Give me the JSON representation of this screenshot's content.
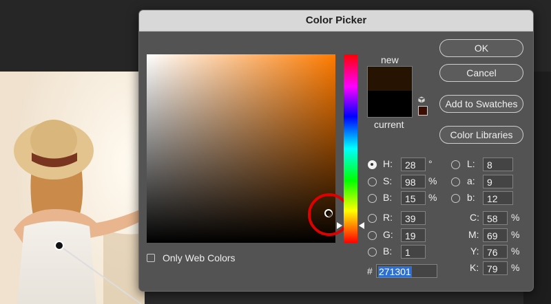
{
  "dialog": {
    "title": "Color Picker",
    "ok_label": "OK",
    "cancel_label": "Cancel",
    "add_swatches_label": "Add to Swatches",
    "color_libraries_label": "Color Libraries",
    "new_label": "new",
    "current_label": "current",
    "only_web_colors_label": "Only Web Colors",
    "only_web_colors_checked": false,
    "new_color": "#271301",
    "current_color": "#000000"
  },
  "fields": {
    "hsb": [
      {
        "label": "H:",
        "value": "28",
        "unit": "°",
        "selected": true
      },
      {
        "label": "S:",
        "value": "98",
        "unit": "%",
        "selected": false
      },
      {
        "label": "B:",
        "value": "15",
        "unit": "%",
        "selected": false
      }
    ],
    "rgb": [
      {
        "label": "R:",
        "value": "39",
        "selected": false
      },
      {
        "label": "G:",
        "value": "19",
        "selected": false
      },
      {
        "label": "B:",
        "value": "1",
        "selected": false
      }
    ],
    "lab": [
      {
        "label": "L:",
        "value": "8",
        "selected": false
      },
      {
        "label": "a:",
        "value": "9",
        "selected": false
      },
      {
        "label": "b:",
        "value": "12",
        "selected": false
      }
    ],
    "cmyk": [
      {
        "label": "C:",
        "value": "58",
        "unit": "%"
      },
      {
        "label": "M:",
        "value": "69",
        "unit": "%"
      },
      {
        "label": "Y:",
        "value": "76",
        "unit": "%"
      },
      {
        "label": "K:",
        "value": "79",
        "unit": "%"
      }
    ],
    "hex_symbol": "#",
    "hex_value": "271301"
  },
  "colors": {
    "hue_base": "#ff7b00",
    "highlight_ring": "#e00000",
    "hex_selection": "#2f6fd0"
  }
}
